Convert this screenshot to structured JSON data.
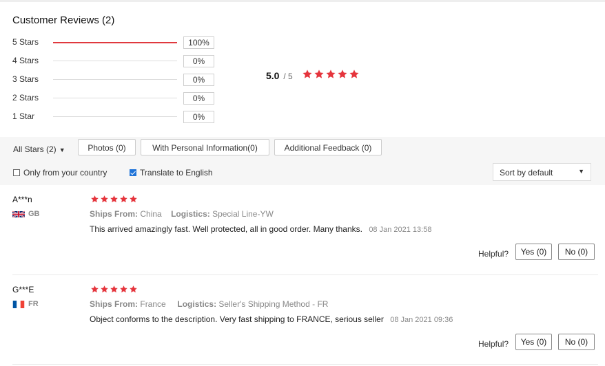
{
  "reviews_section": {
    "title": "Customer Reviews (2)",
    "distribution": [
      {
        "label": "5 Stars",
        "percent_text": "100%",
        "percent": 100
      },
      {
        "label": "4 Stars",
        "percent_text": "0%",
        "percent": 0
      },
      {
        "label": "3 Stars",
        "percent_text": "0%",
        "percent": 0
      },
      {
        "label": "2 Stars",
        "percent_text": "0%",
        "percent": 0
      },
      {
        "label": "1 Star",
        "percent_text": "0%",
        "percent": 0
      }
    ],
    "average": {
      "score": "5.0",
      "out_of": "/ 5",
      "stars": 5
    }
  },
  "filters": {
    "all_stars": "All Stars (2)",
    "buttons": [
      {
        "label": "Photos (0)"
      },
      {
        "label": "With Personal Information(0)"
      },
      {
        "label": "Additional Feedback (0)"
      }
    ],
    "only_country": {
      "label": "Only from your country",
      "checked": false
    },
    "translate": {
      "label": "Translate to English",
      "checked": true
    },
    "sort": {
      "value": "Sort by default"
    }
  },
  "reviews": [
    {
      "user": "A***n",
      "country_code": "GB",
      "flag_icon": "uk-flag-icon",
      "stars": 5,
      "ships_from_label": "Ships From:",
      "ships_from": "China",
      "logistics_label": "Logistics:",
      "logistics": "Special Line-YW",
      "text": "This arrived amazingly fast. Well protected, all in good order. Many thanks.",
      "date": "08 Jan 2021 13:58",
      "helpful_label": "Helpful?",
      "yes": "Yes (0)",
      "no": "No (0)"
    },
    {
      "user": "G***E",
      "country_code": "FR",
      "flag_icon": "france-flag-icon",
      "stars": 5,
      "ships_from_label": "Ships From:",
      "ships_from": "France",
      "logistics_label": "Logistics:",
      "logistics": "Seller's Shipping Method - FR",
      "text": "Object conforms to the description. Very fast shipping to FRANCE, serious seller",
      "date": "08 Jan 2021 09:36",
      "helpful_label": "Helpful?",
      "yes": "Yes (0)",
      "no": "No (0)"
    }
  ],
  "colors": {
    "star": "#e5343c",
    "bar": "#e0393e"
  }
}
